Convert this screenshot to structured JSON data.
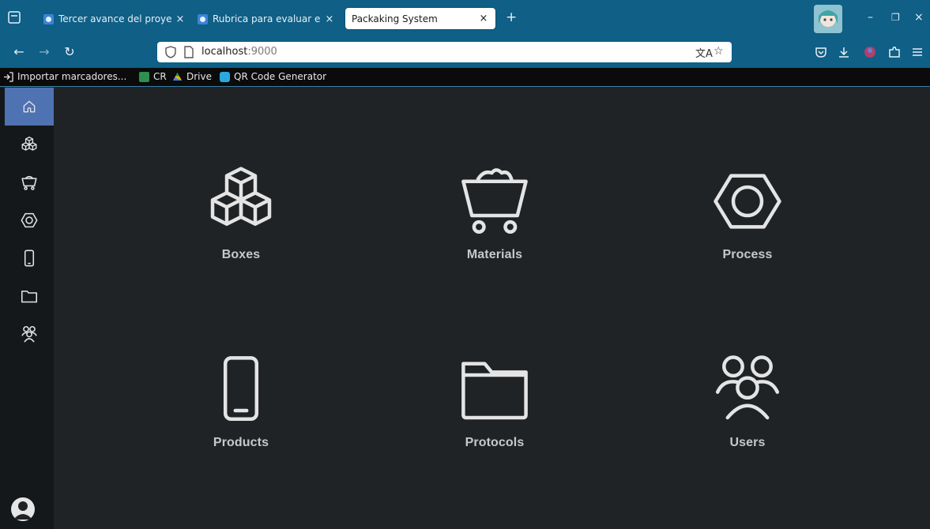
{
  "browser": {
    "tabs": [
      {
        "label": "Tercer avance del proyec",
        "active": false
      },
      {
        "label": "Rubrica para evaluar el p",
        "active": false
      },
      {
        "label": "Packaking System",
        "active": true
      }
    ],
    "url_host": "localhost",
    "url_port": ":9000",
    "bookmarks": [
      {
        "label": "Importar marcadores...",
        "icon": "import-icon"
      },
      {
        "label": "CR",
        "icon": "image-icon"
      },
      {
        "label": "Drive",
        "icon": "drive-icon"
      },
      {
        "label": "QR Code Generator",
        "icon": "qr-icon"
      }
    ]
  },
  "sidebar": {
    "items": [
      {
        "name": "home",
        "icon": "home-icon",
        "active": true
      },
      {
        "name": "boxes",
        "icon": "boxes-icon",
        "active": false
      },
      {
        "name": "materials",
        "icon": "cart-icon",
        "active": false
      },
      {
        "name": "process",
        "icon": "hexnut-icon",
        "active": false
      },
      {
        "name": "products",
        "icon": "phone-icon",
        "active": false
      },
      {
        "name": "protocols",
        "icon": "folder-icon",
        "active": false
      },
      {
        "name": "users",
        "icon": "users-icon",
        "active": false
      }
    ]
  },
  "dashboard": {
    "cards": [
      {
        "label": "Boxes",
        "icon": "boxes-icon"
      },
      {
        "label": "Materials",
        "icon": "cart-icon"
      },
      {
        "label": "Process",
        "icon": "hexnut-icon"
      },
      {
        "label": "Products",
        "icon": "phone-icon"
      },
      {
        "label": "Protocols",
        "icon": "folder-icon"
      },
      {
        "label": "Users",
        "icon": "users-icon"
      }
    ]
  },
  "colors": {
    "chrome": "#0f5f86",
    "sidebar_bg": "#15181a",
    "main_bg": "#1f2326",
    "active_item": "#4f72b3",
    "icon_stroke": "#e4e4e4",
    "label": "#c6c9cc"
  }
}
